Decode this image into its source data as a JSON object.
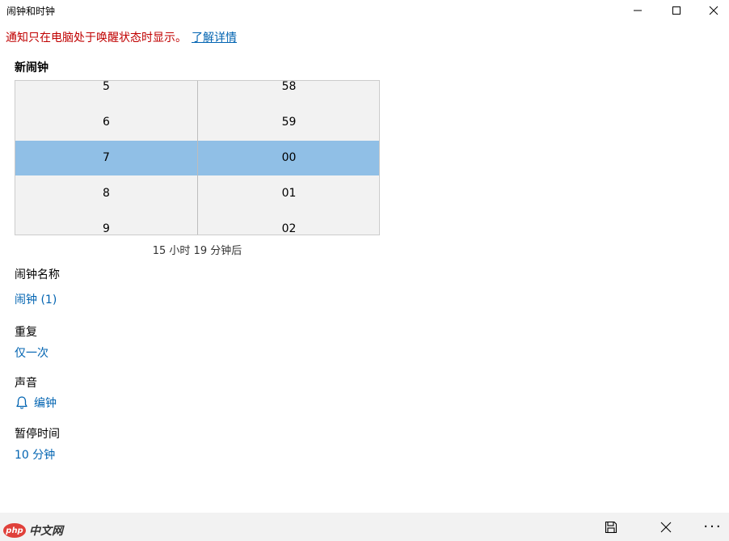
{
  "window": {
    "title": "闹钟和时钟"
  },
  "notice": {
    "text": "通知只在电脑处于唤醒状态时显示。",
    "link": "了解详情"
  },
  "new_alarm": {
    "heading": "新闹钟",
    "hours": [
      "5",
      "6",
      "7",
      "8",
      "9"
    ],
    "minutes": [
      "58",
      "59",
      "00",
      "01",
      "02"
    ],
    "selected_hour": "7",
    "selected_minute": "00",
    "time_until": "15 小时 19 分钟后"
  },
  "fields": {
    "name_label": "闹钟名称",
    "name_value": "闹钟 (1)",
    "repeat_label": "重复",
    "repeat_value": "仅一次",
    "sound_label": "声音",
    "sound_value": "编钟",
    "sound_icon": "bell-icon",
    "snooze_label": "暂停时间",
    "snooze_value": "10 分钟"
  },
  "bottom_bar": {
    "save_icon": "save-icon",
    "cancel_icon": "close-icon",
    "more_label": "···"
  },
  "watermark": {
    "logo_text": "php",
    "text": "中文网"
  },
  "colors": {
    "accent": "#0063b1",
    "notice": "#c00000",
    "selection": "#90bfe6",
    "picker_bg": "#f2f2f2"
  }
}
